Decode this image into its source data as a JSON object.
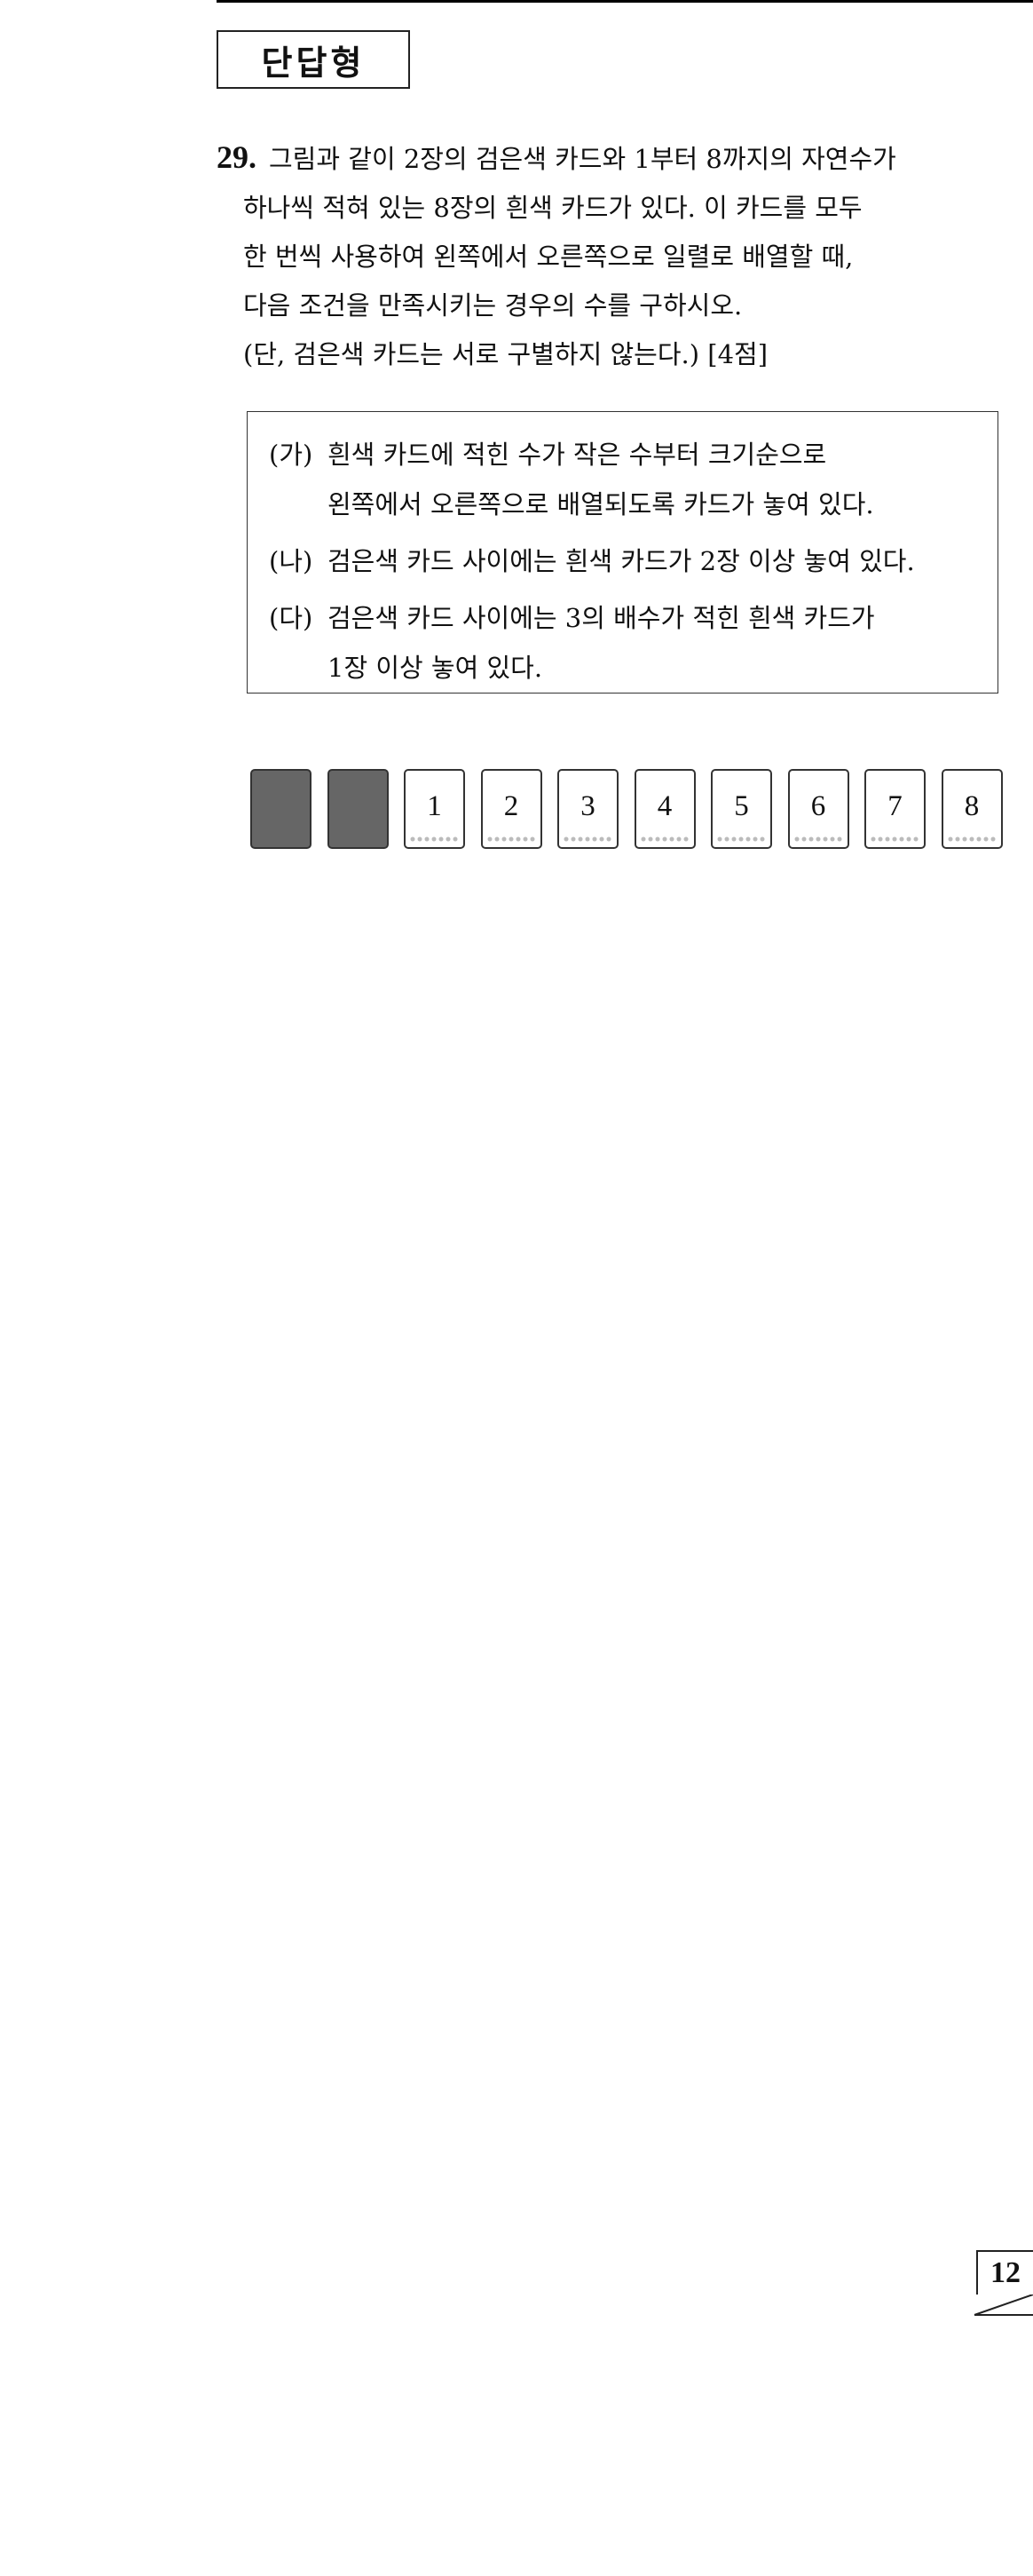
{
  "section_title": "단답형",
  "problem": {
    "number": "29.",
    "lines": [
      "그림과 같이 2장의 검은색 카드와 1부터 8까지의 자연수가",
      "하나씩 적혀 있는 8장의 흰색 카드가 있다. 이 카드를 모두",
      "한 번씩 사용하여 왼쪽에서 오른쪽으로 일렬로 배열할 때,",
      "다음 조건을 만족시키는 경우의 수를 구하시오.",
      "(단, 검은색 카드는 서로 구별하지 않는다.) [4점]"
    ]
  },
  "conditions": [
    {
      "label": "(가)",
      "text": "흰색 카드에 적힌 수가 작은 수부터 크기순으로",
      "cont": "왼쪽에서 오른쪽으로 배열되도록 카드가 놓여 있다."
    },
    {
      "label": "(나)",
      "text": "검은색 카드 사이에는 흰색 카드가 2장 이상 놓여 있다.",
      "cont": ""
    },
    {
      "label": "(다)",
      "text": "검은색 카드 사이에는 3의 배수가 적힌 흰색 카드가",
      "cont": "1장 이상 놓여 있다."
    }
  ],
  "cards": {
    "black_count": 2,
    "white_numbers": [
      "1",
      "2",
      "3",
      "4",
      "5",
      "6",
      "7",
      "8"
    ],
    "black_color": "#666666"
  },
  "page_number": "12"
}
